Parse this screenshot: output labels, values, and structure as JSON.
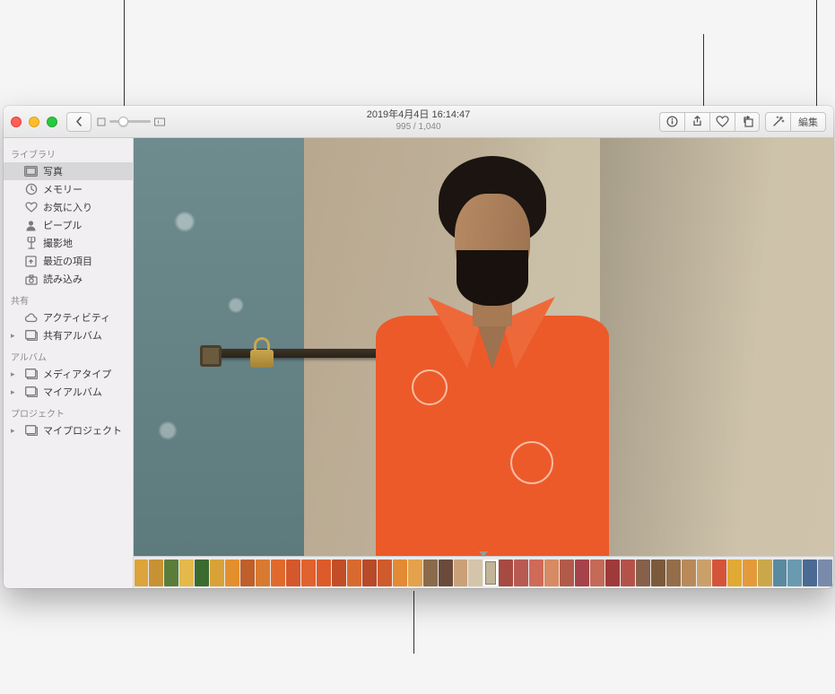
{
  "title": "2019年4月4日 16:14:47",
  "subtitle": "995 / 1,040",
  "toolbar": {
    "edit_label": "編集"
  },
  "sidebar": {
    "sections": [
      {
        "header": "ライブラリ",
        "items": [
          {
            "icon": "photos",
            "label": "写真",
            "selected": true,
            "disclosure": false
          },
          {
            "icon": "memories",
            "label": "メモリー",
            "selected": false,
            "disclosure": false
          },
          {
            "icon": "heart",
            "label": "お気に入り",
            "selected": false,
            "disclosure": false
          },
          {
            "icon": "person",
            "label": "ピープル",
            "selected": false,
            "disclosure": false
          },
          {
            "icon": "pin",
            "label": "撮影地",
            "selected": false,
            "disclosure": false
          },
          {
            "icon": "recent",
            "label": "最近の項目",
            "selected": false,
            "disclosure": false
          },
          {
            "icon": "import",
            "label": "読み込み",
            "selected": false,
            "disclosure": false
          }
        ]
      },
      {
        "header": "共有",
        "items": [
          {
            "icon": "cloud",
            "label": "アクティビティ",
            "selected": false,
            "disclosure": false
          },
          {
            "icon": "album",
            "label": "共有アルバム",
            "selected": false,
            "disclosure": true
          }
        ]
      },
      {
        "header": "アルバム",
        "items": [
          {
            "icon": "album",
            "label": "メディアタイプ",
            "selected": false,
            "disclosure": true
          },
          {
            "icon": "album",
            "label": "マイアルバム",
            "selected": false,
            "disclosure": true
          }
        ]
      },
      {
        "header": "プロジェクト",
        "items": [
          {
            "icon": "album",
            "label": "マイプロジェクト",
            "selected": false,
            "disclosure": true
          }
        ]
      }
    ]
  },
  "filmstrip_colors": [
    "#dca43a",
    "#c79234",
    "#5a7d3a",
    "#e4b84a",
    "#3b6a2e",
    "#d9a238",
    "#e38f2e",
    "#bf5f2a",
    "#d87a30",
    "#e06a2c",
    "#d4582b",
    "#e0622e",
    "#dd5a2a",
    "#c14e26",
    "#d86a30",
    "#b74a28",
    "#cf5a2c",
    "#e38a34",
    "#e4a24a",
    "#8a6a4a",
    "#6a4a3a",
    "#caa078",
    "#d4c4aa",
    "#c2b498",
    "#a64a42",
    "#b85a52",
    "#cf6a58",
    "#d88a62",
    "#b25a4a",
    "#a6424a",
    "#c46a56",
    "#9e3a3a",
    "#b4524a",
    "#86604a",
    "#7a5a3a",
    "#946e4a",
    "#b88a5a",
    "#caa06a",
    "#d4543a",
    "#e0aa34",
    "#e49a3a",
    "#caa84a",
    "#5a8aa0",
    "#6a9ab0",
    "#4a6a94",
    "#7a8aaa"
  ]
}
